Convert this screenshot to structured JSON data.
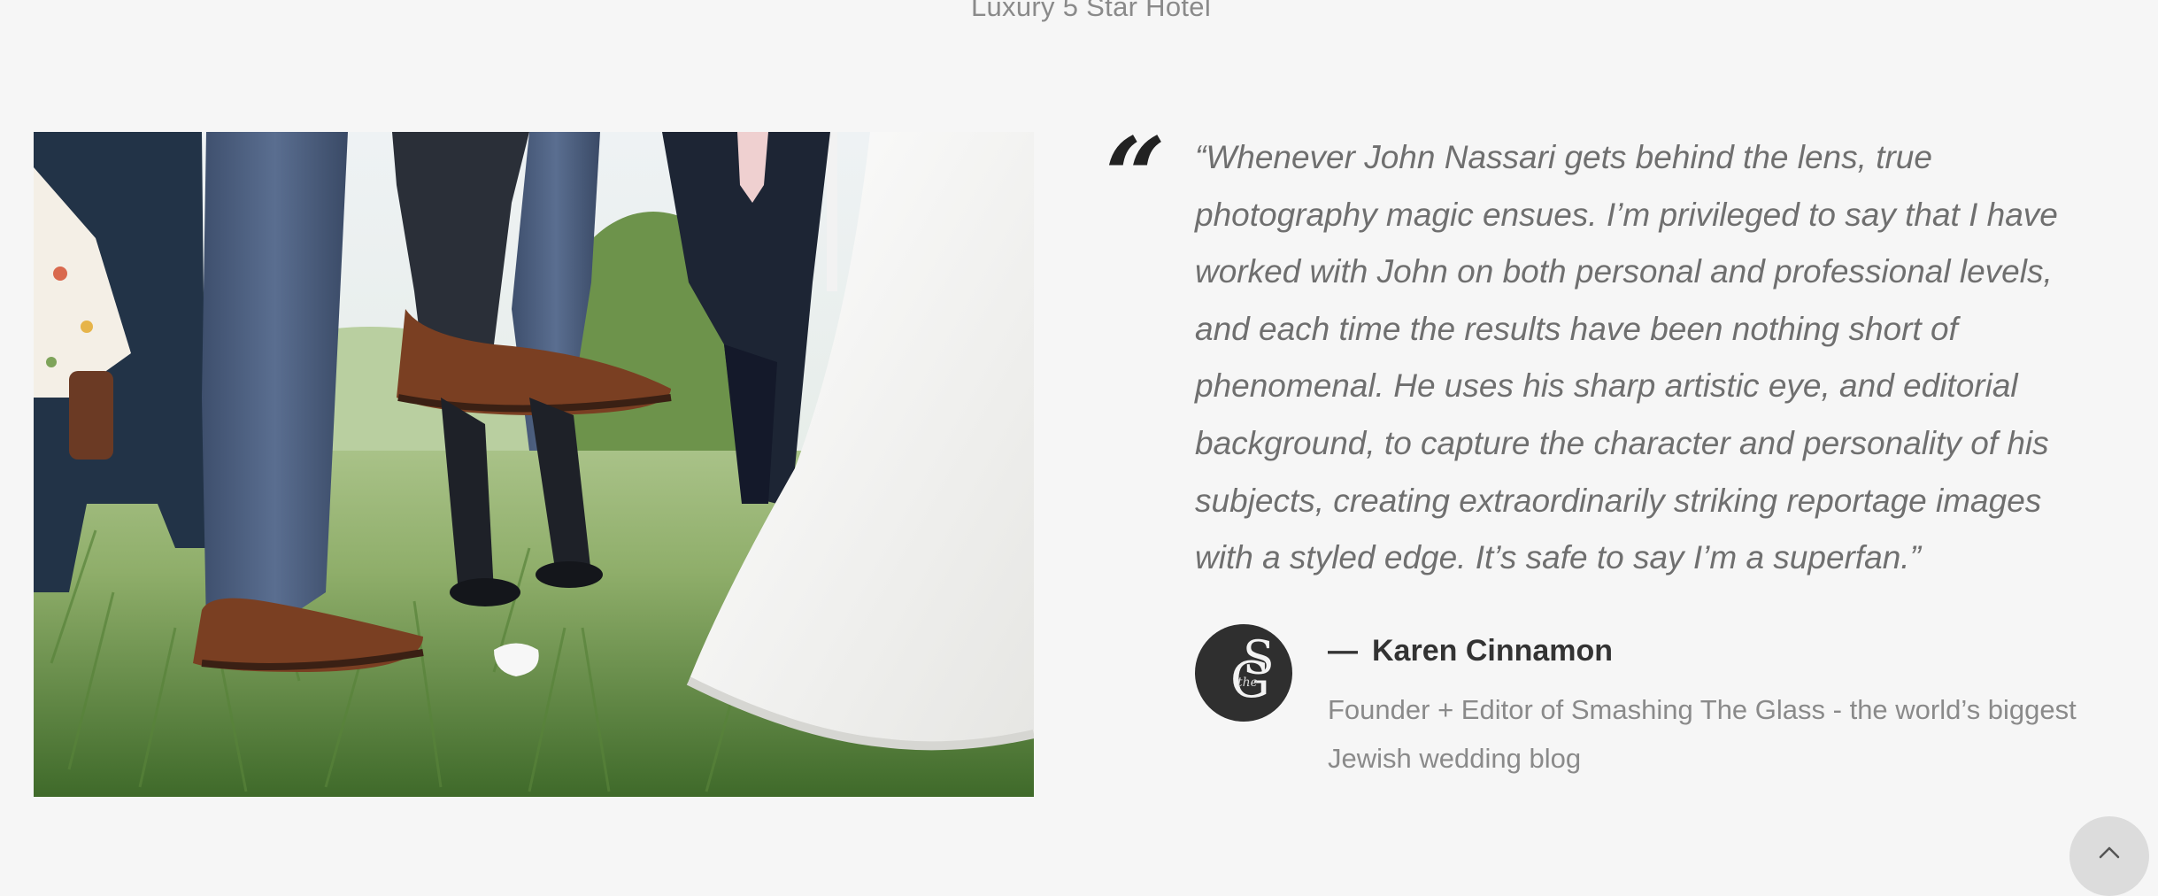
{
  "header": {
    "caption": "Luxury 5 Star Hotel"
  },
  "testimonial": {
    "quote_mark": "“",
    "quote": "“Whenever John Nassari gets behind the lens, true photography magic ensues. I’m privileged to say that I have worked with John on both personal and professional levels, and each time the results have been nothing short of phenomenal. He uses his sharp artistic eye, and editorial background, to capture the character and personality of his subjects, creating extraordinarily striking reportage images with a styled edge. It’s safe to say I’m a superfan.”",
    "author_dash": "—",
    "author_name": "Karen Cinnamon",
    "author_title": "Founder + Editor of Smashing The Glass - the world’s biggest Jewish wedding blog",
    "avatar_logo": {
      "letters_main": "S",
      "letters_secondary": "G",
      "letters_small": "the"
    }
  },
  "controls": {
    "scroll_top_icon": "chevron-up-icon"
  },
  "colors": {
    "background": "#f6f6f6",
    "avatar_bg": "#2f2f2f",
    "scroll_button_bg": "#dcdcdc",
    "quote_text": "#6f6f6f"
  }
}
